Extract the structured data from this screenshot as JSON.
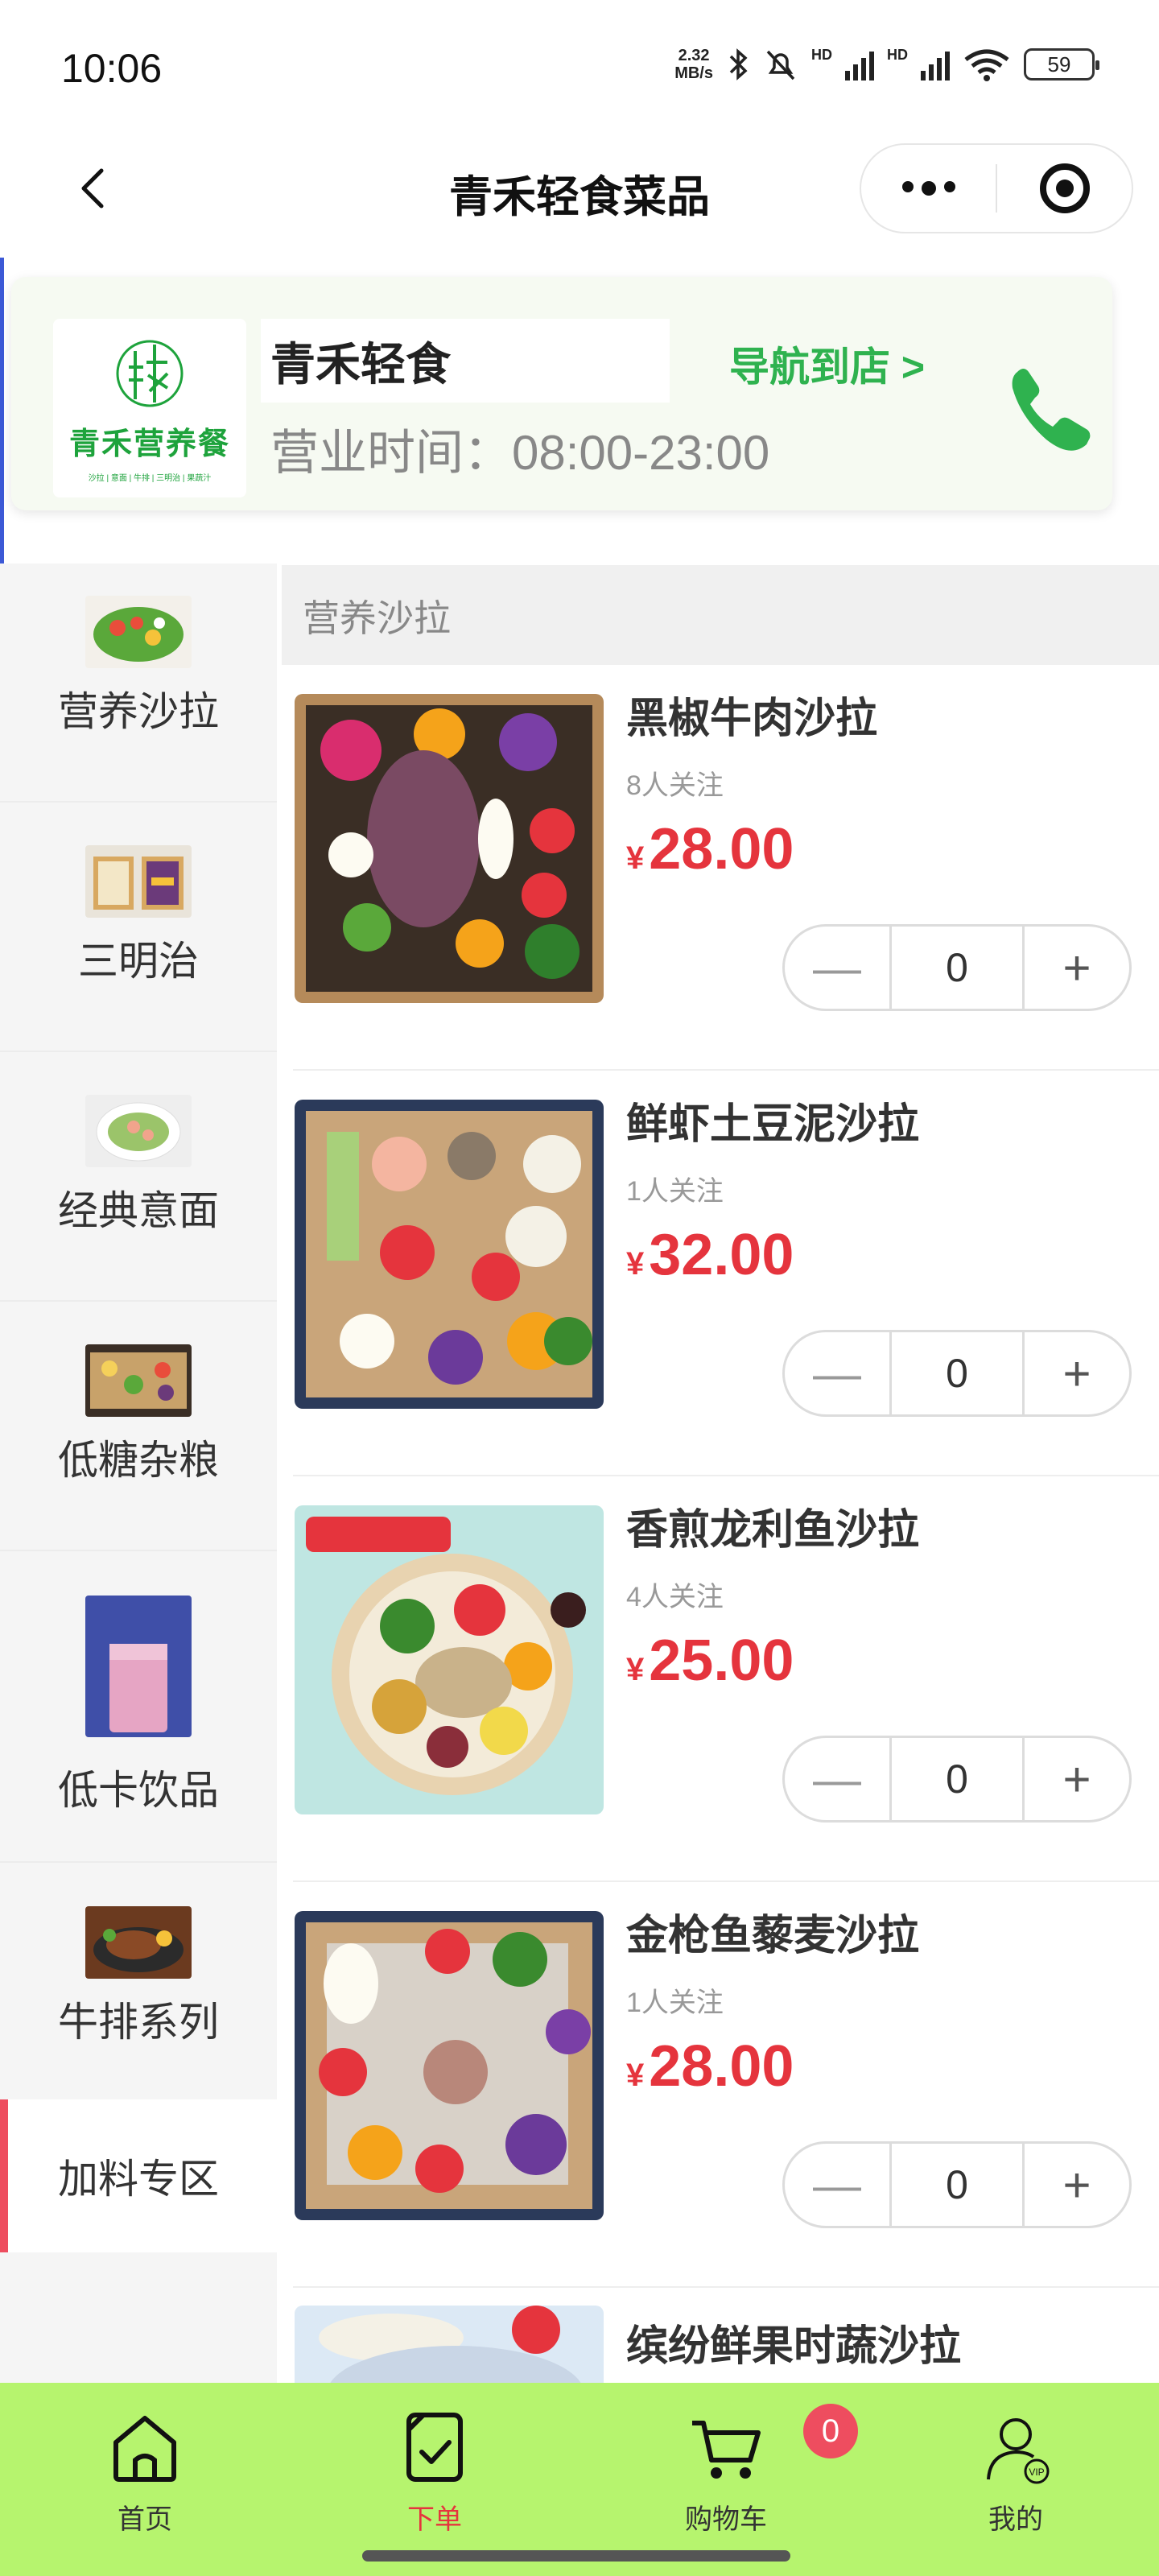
{
  "status_bar": {
    "time": "10:06",
    "net_speed_value": "2.32",
    "net_speed_unit": "MB/s",
    "hd1": "HD",
    "hd2": "HD",
    "battery": "59"
  },
  "nav": {
    "title": "青禾轻食菜品"
  },
  "store": {
    "logo_text": "青禾营养餐",
    "logo_sub": "沙拉 | 意面 | 牛排 | 三明治 | 果蔬汁",
    "name": "青禾轻食",
    "hours": "营业时间：08:00-23:00",
    "navigate_label": "导航到店 >"
  },
  "categories": [
    {
      "label": "营养沙拉"
    },
    {
      "label": "三明治"
    },
    {
      "label": "经典意面"
    },
    {
      "label": "低糖杂粮"
    },
    {
      "label": "低卡饮品"
    },
    {
      "label": "牛排系列"
    },
    {
      "label": "加料专区"
    }
  ],
  "section": {
    "title": "营养沙拉"
  },
  "products": [
    {
      "name": "黑椒牛肉沙拉",
      "follow": "8人关注",
      "currency": "¥",
      "price": "28.00",
      "qty": "0"
    },
    {
      "name": "鲜虾土豆泥沙拉",
      "follow": "1人关注",
      "currency": "¥",
      "price": "32.00",
      "qty": "0"
    },
    {
      "name": "香煎龙利鱼沙拉",
      "follow": "4人关注",
      "currency": "¥",
      "price": "25.00",
      "qty": "0"
    },
    {
      "name": "金枪鱼藜麦沙拉",
      "follow": "1人关注",
      "currency": "¥",
      "price": "28.00",
      "qty": "0"
    },
    {
      "name": "缤纷鲜果时蔬沙拉"
    }
  ],
  "stepper": {
    "minus": "—",
    "plus": "+"
  },
  "tabs": [
    {
      "label": "首页"
    },
    {
      "label": "下单"
    },
    {
      "label": "购物车"
    },
    {
      "label": "我的"
    }
  ],
  "cart_badge": "0",
  "colors": {
    "accent_green": "#2fb24f",
    "price_red": "#e5343d",
    "tab_bar_bg": "#b6f46e",
    "active_marker": "#ee4d5f"
  }
}
